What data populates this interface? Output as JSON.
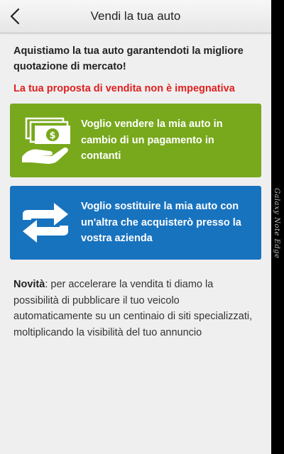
{
  "header": {
    "title": "Vendi la tua auto",
    "back_icon": "chevron-left-icon"
  },
  "intro": "Aquistiamo la tua auto garantendoti la migliore quotazione di mercato!",
  "notice": "La tua proposta di vendita non è impegnativa",
  "options": [
    {
      "label": "Voglio vendere la mia auto in cambio di un pagamento in contanti",
      "icon": "cash-in-hand-icon",
      "color": "#78a81c"
    },
    {
      "label": "Voglio sostituire la mia auto con un'altra che acquisterò presso la vostra azienda",
      "icon": "swap-arrows-icon",
      "color": "#1873bf"
    }
  ],
  "news": {
    "title": "Novità",
    "body": ": per accelerare la vendita ti diamo la possibilità di pubblicare il tuo veicolo automaticamente su un centinaio di siti specializzati, moltiplicando la visibilità del tuo annuncio"
  },
  "device_edge_label": "Galaxy Note Edge"
}
